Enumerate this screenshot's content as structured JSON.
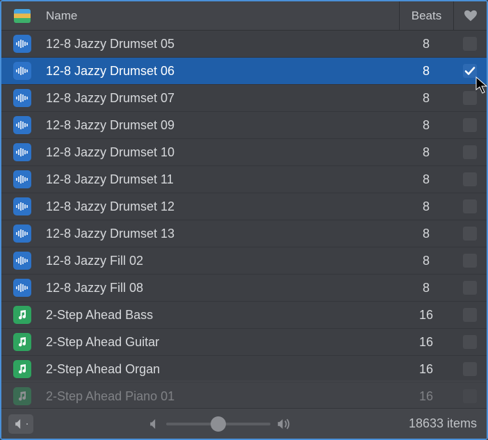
{
  "header": {
    "name_label": "Name",
    "beats_label": "Beats"
  },
  "rows": [
    {
      "name": "12-8 Jazzy Drumset 05",
      "beats": "8",
      "type": "audio",
      "selected": false,
      "favorite": false
    },
    {
      "name": "12-8 Jazzy Drumset 06",
      "beats": "8",
      "type": "audio",
      "selected": true,
      "favorite": true
    },
    {
      "name": "12-8 Jazzy Drumset 07",
      "beats": "8",
      "type": "audio",
      "selected": false,
      "favorite": false
    },
    {
      "name": "12-8 Jazzy Drumset 09",
      "beats": "8",
      "type": "audio",
      "selected": false,
      "favorite": false
    },
    {
      "name": "12-8 Jazzy Drumset 10",
      "beats": "8",
      "type": "audio",
      "selected": false,
      "favorite": false
    },
    {
      "name": "12-8 Jazzy Drumset 11",
      "beats": "8",
      "type": "audio",
      "selected": false,
      "favorite": false
    },
    {
      "name": "12-8 Jazzy Drumset 12",
      "beats": "8",
      "type": "audio",
      "selected": false,
      "favorite": false
    },
    {
      "name": "12-8 Jazzy Drumset 13",
      "beats": "8",
      "type": "audio",
      "selected": false,
      "favorite": false
    },
    {
      "name": "12-8 Jazzy Fill 02",
      "beats": "8",
      "type": "audio",
      "selected": false,
      "favorite": false
    },
    {
      "name": "12-8 Jazzy Fill 08",
      "beats": "8",
      "type": "audio",
      "selected": false,
      "favorite": false
    },
    {
      "name": "2-Step Ahead Bass",
      "beats": "16",
      "type": "midi",
      "selected": false,
      "favorite": false
    },
    {
      "name": "2-Step Ahead Guitar",
      "beats": "16",
      "type": "midi",
      "selected": false,
      "favorite": false
    },
    {
      "name": "2-Step Ahead Organ",
      "beats": "16",
      "type": "midi",
      "selected": false,
      "favorite": false
    },
    {
      "name": "2-Step Ahead Piano 01",
      "beats": "16",
      "type": "midi",
      "selected": false,
      "favorite": false
    }
  ],
  "footer": {
    "item_count": "18633 items"
  }
}
